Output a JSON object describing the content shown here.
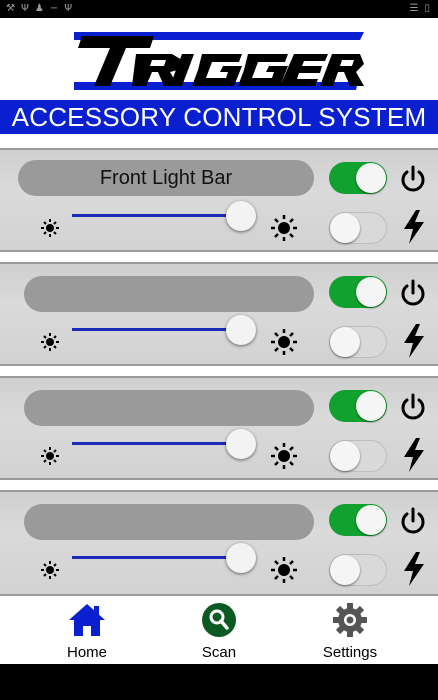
{
  "status_bar": {
    "left_icons": [
      "wrench-icon",
      "usb-icon",
      "person-icon",
      "clip-icon",
      "usb-icon"
    ],
    "right_icons": [
      "wifi-icon",
      "battery-icon"
    ]
  },
  "app": {
    "logo_text": "TRIGGER",
    "banner": "ACCESSORY CONTROL SYSTEM"
  },
  "accessories": [
    {
      "name": "Front Light Bar",
      "power_on": true,
      "strobe_on": false,
      "brightness": 1.0
    },
    {
      "name": "",
      "power_on": true,
      "strobe_on": false,
      "brightness": 1.0
    },
    {
      "name": "",
      "power_on": true,
      "strobe_on": false,
      "brightness": 1.0
    },
    {
      "name": "",
      "power_on": true,
      "strobe_on": false,
      "brightness": 1.0
    }
  ],
  "nav": {
    "home": "Home",
    "scan": "Scan",
    "settings": "Settings"
  },
  "colors": {
    "banner": "#0a1fcf",
    "toggle_on": "#11a12f",
    "slider": "#1b2bb8",
    "nav_home": "#0a1fcf",
    "nav_scan": "#0b5a22"
  }
}
